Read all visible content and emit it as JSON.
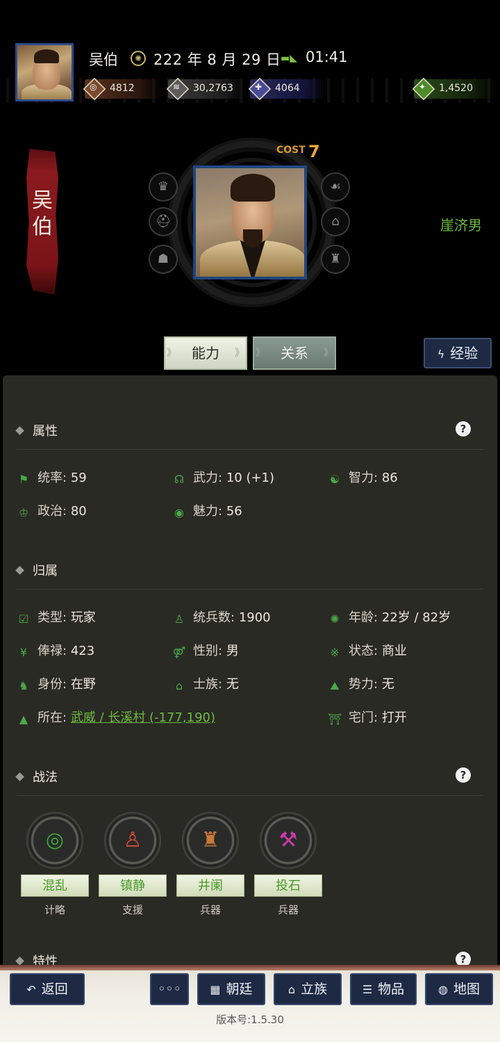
{
  "header": {
    "name": "吴伯",
    "date": "222 年 8 月 29 日",
    "time": "01:41",
    "resources": {
      "money": "4812",
      "food": "30,2763",
      "troops": "4064",
      "gems": "1,4520"
    }
  },
  "hero": {
    "banner_name_line1": "吴",
    "banner_name_line2": "伯",
    "cost_label": "COST",
    "cost_value": "7",
    "spouse": "崖济男"
  },
  "tabs": {
    "ability": "能力",
    "relations": "关系",
    "experience": "经验"
  },
  "attributes": {
    "title": "属性",
    "items": [
      {
        "label": "统率:",
        "value": "59"
      },
      {
        "label": "武力:",
        "value": "10 (+1)"
      },
      {
        "label": "智力:",
        "value": "86"
      },
      {
        "label": "政治:",
        "value": "80"
      },
      {
        "label": "魅力:",
        "value": "56"
      }
    ]
  },
  "affiliation": {
    "title": "归属",
    "items": [
      {
        "label": "类型:",
        "value": "玩家"
      },
      {
        "label": "统兵数:",
        "value": "1900"
      },
      {
        "label": "年龄:",
        "value": "22岁 / 82岁"
      },
      {
        "label": "俸禄:",
        "value": "423"
      },
      {
        "label": "性别:",
        "value": "男"
      },
      {
        "label": "状态:",
        "value": "商业"
      },
      {
        "label": "身份:",
        "value": "在野"
      },
      {
        "label": "士族:",
        "value": "无"
      },
      {
        "label": "势力:",
        "value": "无"
      },
      {
        "label": "所在:",
        "value": "武威 / 长溪村 (-177,190)"
      },
      {
        "label": "宅门:",
        "value": "打开"
      }
    ]
  },
  "tactics": {
    "title": "战法",
    "skills": [
      {
        "name": "混乱",
        "category": "计略",
        "icon": "swirl-icon",
        "color": "#3aa83a"
      },
      {
        "name": "镇静",
        "category": "支援",
        "icon": "figure-icon",
        "color": "#d84a3a"
      },
      {
        "name": "井阑",
        "category": "兵器",
        "icon": "tower-icon",
        "color": "#c8783a"
      },
      {
        "name": "投石",
        "category": "兵器",
        "icon": "catapult-icon",
        "color": "#c83aa8"
      }
    ]
  },
  "traits": {
    "title": "特性"
  },
  "bottom_nav": {
    "back": "返回",
    "more": "◦◦◦",
    "court": "朝廷",
    "clan": "立族",
    "items": "物品",
    "map": "地图"
  },
  "version": "版本号:1.5.30"
}
